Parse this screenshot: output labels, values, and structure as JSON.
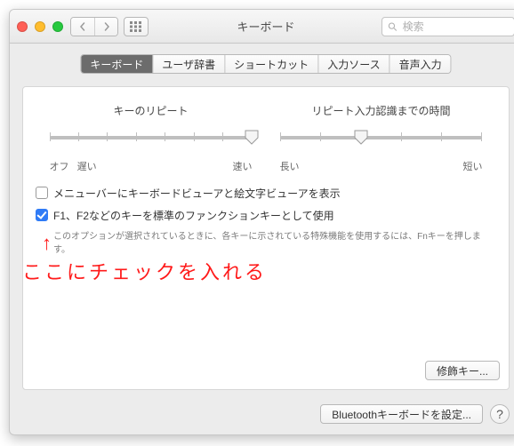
{
  "window": {
    "title": "キーボード",
    "search_placeholder": "検索",
    "search_value": ""
  },
  "tabs": [
    {
      "label": "キーボード",
      "active": true
    },
    {
      "label": "ユーザ辞書",
      "active": false
    },
    {
      "label": "ショートカット",
      "active": false
    },
    {
      "label": "入力ソース",
      "active": false
    },
    {
      "label": "音声入力",
      "active": false
    }
  ],
  "sliders": {
    "repeat": {
      "title": "キーのリピート",
      "left_label": "オフ",
      "left_extra": "遅い",
      "right_label": "速い",
      "ticks": 8,
      "value": 7,
      "min": 0,
      "max": 7
    },
    "delay": {
      "title": "リピート入力認識までの時間",
      "left_label": "長い",
      "right_label": "短い",
      "ticks": 6,
      "value": 2,
      "min": 0,
      "max": 5
    }
  },
  "checks": {
    "menubar_viewer": {
      "checked": false,
      "label": "メニューバーにキーボードビューアと絵文字ビューアを表示"
    },
    "fn_keys": {
      "checked": true,
      "label": "F1、F2などのキーを標準のファンクションキーとして使用",
      "note": "このオプションが選択されているときに、各キーに示されている特殊機能を使用するには、Fnキーを押します。"
    }
  },
  "buttons": {
    "modifier": "修飾キー...",
    "bluetooth": "Bluetoothキーボードを設定...",
    "help": "?"
  },
  "annotation": {
    "arrow": "↑",
    "text": "ここにチェックを入れる"
  }
}
